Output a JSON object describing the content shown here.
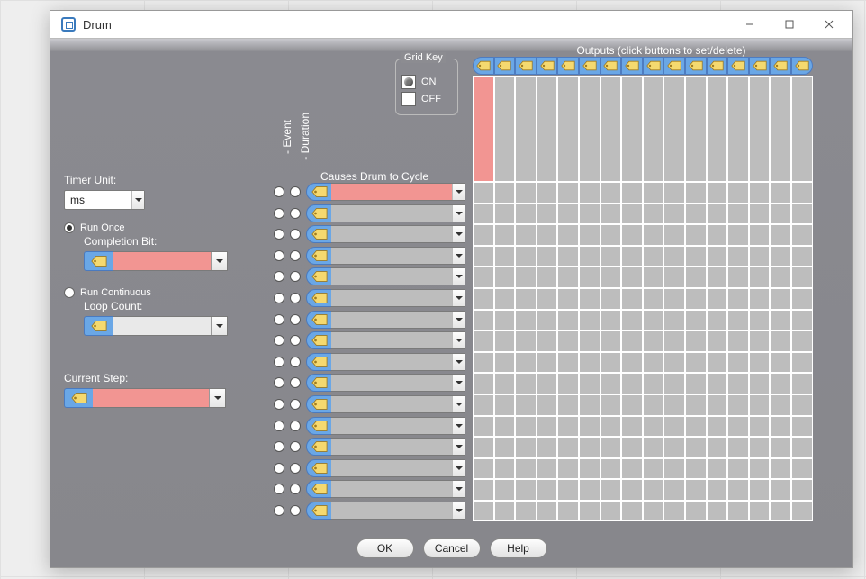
{
  "window": {
    "title": "Drum"
  },
  "left": {
    "timer_unit_label": "Timer Unit:",
    "timer_unit_value": "ms",
    "run_once_label": "Run Once",
    "completion_bit_label": "Completion Bit:",
    "run_continuous_label": "Run Continuous",
    "loop_count_label": "Loop Count:",
    "current_step_label": "Current Step:"
  },
  "center": {
    "event_label": "- Event",
    "duration_label": "- Duration",
    "causes_label": "Causes Drum to Cycle"
  },
  "grid_key": {
    "title": "Grid Key",
    "on": "ON",
    "off": "OFF"
  },
  "outputs_label": "Outputs (click buttons to set/delete)",
  "buttons": {
    "ok": "OK",
    "cancel": "Cancel",
    "help": "Help"
  },
  "grid": {
    "columns": 16,
    "rows": 16,
    "tall_row_span": 5,
    "step_rows": 16
  }
}
